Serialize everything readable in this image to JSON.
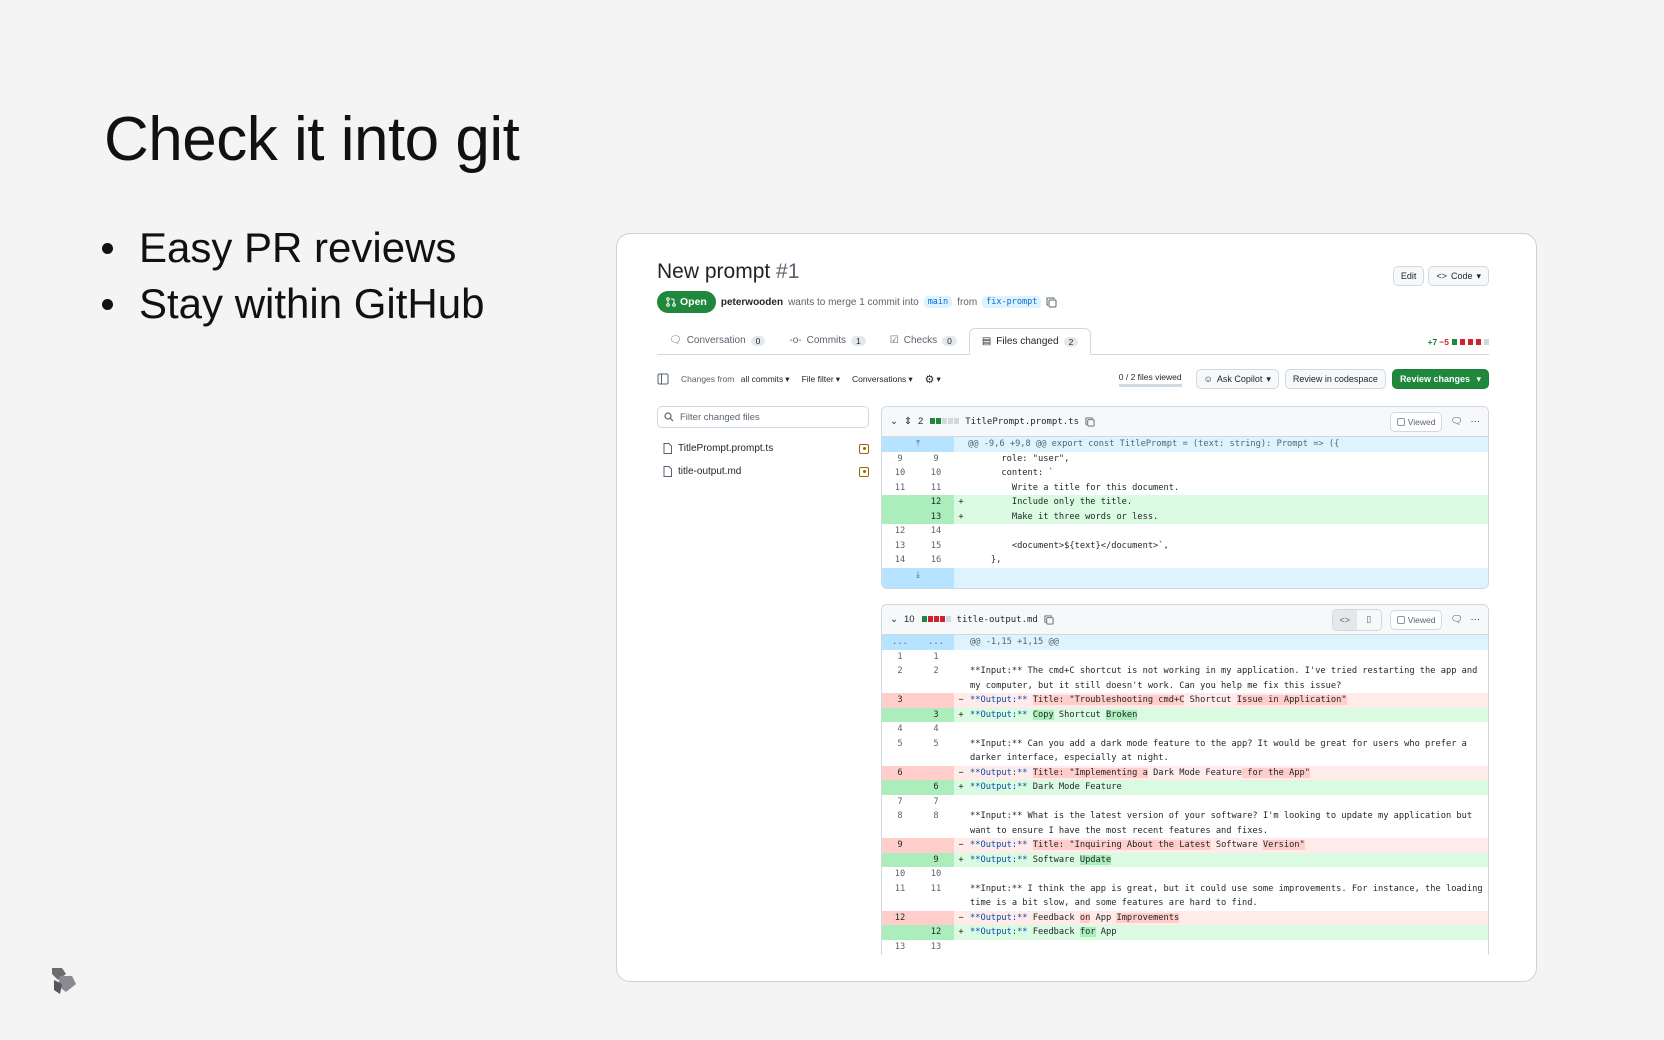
{
  "slide": {
    "title": "Check it into git",
    "bullets": [
      "Easy PR reviews",
      "Stay within GitHub"
    ]
  },
  "pr": {
    "title": "New prompt",
    "number": "#1",
    "edit_label": "Edit",
    "code_label": "Code",
    "status": "Open",
    "author": "peterwooden",
    "merge_text": "wants to merge 1 commit into",
    "base_branch": "main",
    "from_text": "from",
    "head_branch": "fix-prompt"
  },
  "tabs": [
    {
      "label": "Conversation",
      "count": "0"
    },
    {
      "label": "Commits",
      "count": "1"
    },
    {
      "label": "Checks",
      "count": "0"
    },
    {
      "label": "Files changed",
      "count": "2"
    }
  ],
  "diffstat": {
    "additions": "+7",
    "deletions": "−5"
  },
  "toolbar": {
    "changes_from": "Changes from",
    "all_commits": "all commits",
    "file_filter": "File filter",
    "conversations": "Conversations",
    "files_viewed": "0 / 2 files viewed",
    "ask_copilot": "Ask Copilot",
    "review_codespace": "Review in codespace",
    "review_changes": "Review changes"
  },
  "sidebar": {
    "filter_placeholder": "Filter changed files",
    "files": [
      "TitlePrompt.prompt.ts",
      "title-output.md"
    ]
  },
  "file1": {
    "name": "TitlePrompt.prompt.ts",
    "changes": "2",
    "viewed_label": "Viewed",
    "hunk": "@@ -9,6 +9,8 @@ export const TitlePrompt = (text: string): Prompt => ({",
    "lines": [
      {
        "old": "9",
        "new": "9",
        "code": "      role: \"user\","
      },
      {
        "old": "10",
        "new": "10",
        "code": "      content: `"
      },
      {
        "old": "11",
        "new": "11",
        "code": "        Write a title for this document."
      },
      {
        "old": "",
        "new": "12",
        "code": "        Include only the title."
      },
      {
        "old": "",
        "new": "13",
        "code": "        Make it three words or less."
      },
      {
        "old": "12",
        "new": "14",
        "code": ""
      },
      {
        "old": "13",
        "new": "15",
        "code": "        <document>${text}</document>`,"
      },
      {
        "old": "14",
        "new": "16",
        "code": "    },"
      }
    ]
  },
  "file2": {
    "name": "title-output.md",
    "changes": "10",
    "viewed_label": "Viewed",
    "hunk_prefix": "...",
    "hunk": "@@ -1,15 +1,15 @@",
    "lines": {
      "l1": {
        "old": "1",
        "new": "1"
      },
      "l2": {
        "old": "2",
        "new": "2",
        "code": "**Input:** The cmd+C shortcut is not working in my application. I've tried restarting the app and my computer, but it still doesn't work. Can you help me fix this issue?"
      },
      "l3d": {
        "old": "3",
        "a": "**Output:** ",
        "b": "Title: \"Troubleshooting cmd+C",
        "c": " Shortcut ",
        "d": "Issue in Application\""
      },
      "l3a": {
        "new": "3",
        "a": "**Output:** ",
        "b": "Copy",
        "c": " Shortcut ",
        "d": "Broken"
      },
      "l4": {
        "old": "4",
        "new": "4"
      },
      "l5": {
        "old": "5",
        "new": "5",
        "code": "**Input:** Can you add a dark mode feature to the app? It would be great for users who prefer a darker interface, especially at night."
      },
      "l6d": {
        "old": "6",
        "a": "**Output:** ",
        "b": "Title: \"Implementing a",
        "c": " Dark Mode Feature",
        "d": " for the App\""
      },
      "l6a": {
        "new": "6",
        "a": "**Output:** ",
        "c": "Dark Mode Feature"
      },
      "l7": {
        "old": "7",
        "new": "7"
      },
      "l8": {
        "old": "8",
        "new": "8",
        "code": "**Input:** What is the latest version of your software? I'm looking to update my application but want to ensure I have the most recent features and fixes."
      },
      "l9d": {
        "old": "9",
        "a": "**Output:** ",
        "b": "Title: \"Inquiring About the Latest",
        "c": " Software ",
        "d": "Version\""
      },
      "l9a": {
        "new": "9",
        "a": "**Output:** ",
        "c": "Software ",
        "d": "Update"
      },
      "l10": {
        "old": "10",
        "new": "10"
      },
      "l11": {
        "old": "11",
        "new": "11",
        "code": "**Input:** I think the app is great, but it could use some improvements. For instance, the loading time is a bit slow, and some features are hard to find."
      },
      "l12d": {
        "old": "12",
        "a": "**Output:** ",
        "c": "Feedback ",
        "b": "on",
        "e": " App ",
        "d": "Improvements"
      },
      "l12a": {
        "new": "12",
        "a": "**Output:** ",
        "c": "Feedback ",
        "b": "for",
        "e": " App"
      },
      "l13": {
        "old": "13",
        "new": "13"
      }
    }
  },
  "colors": {
    "green": "#1f883d",
    "red": "#cf222e",
    "blue": "#0969da"
  }
}
